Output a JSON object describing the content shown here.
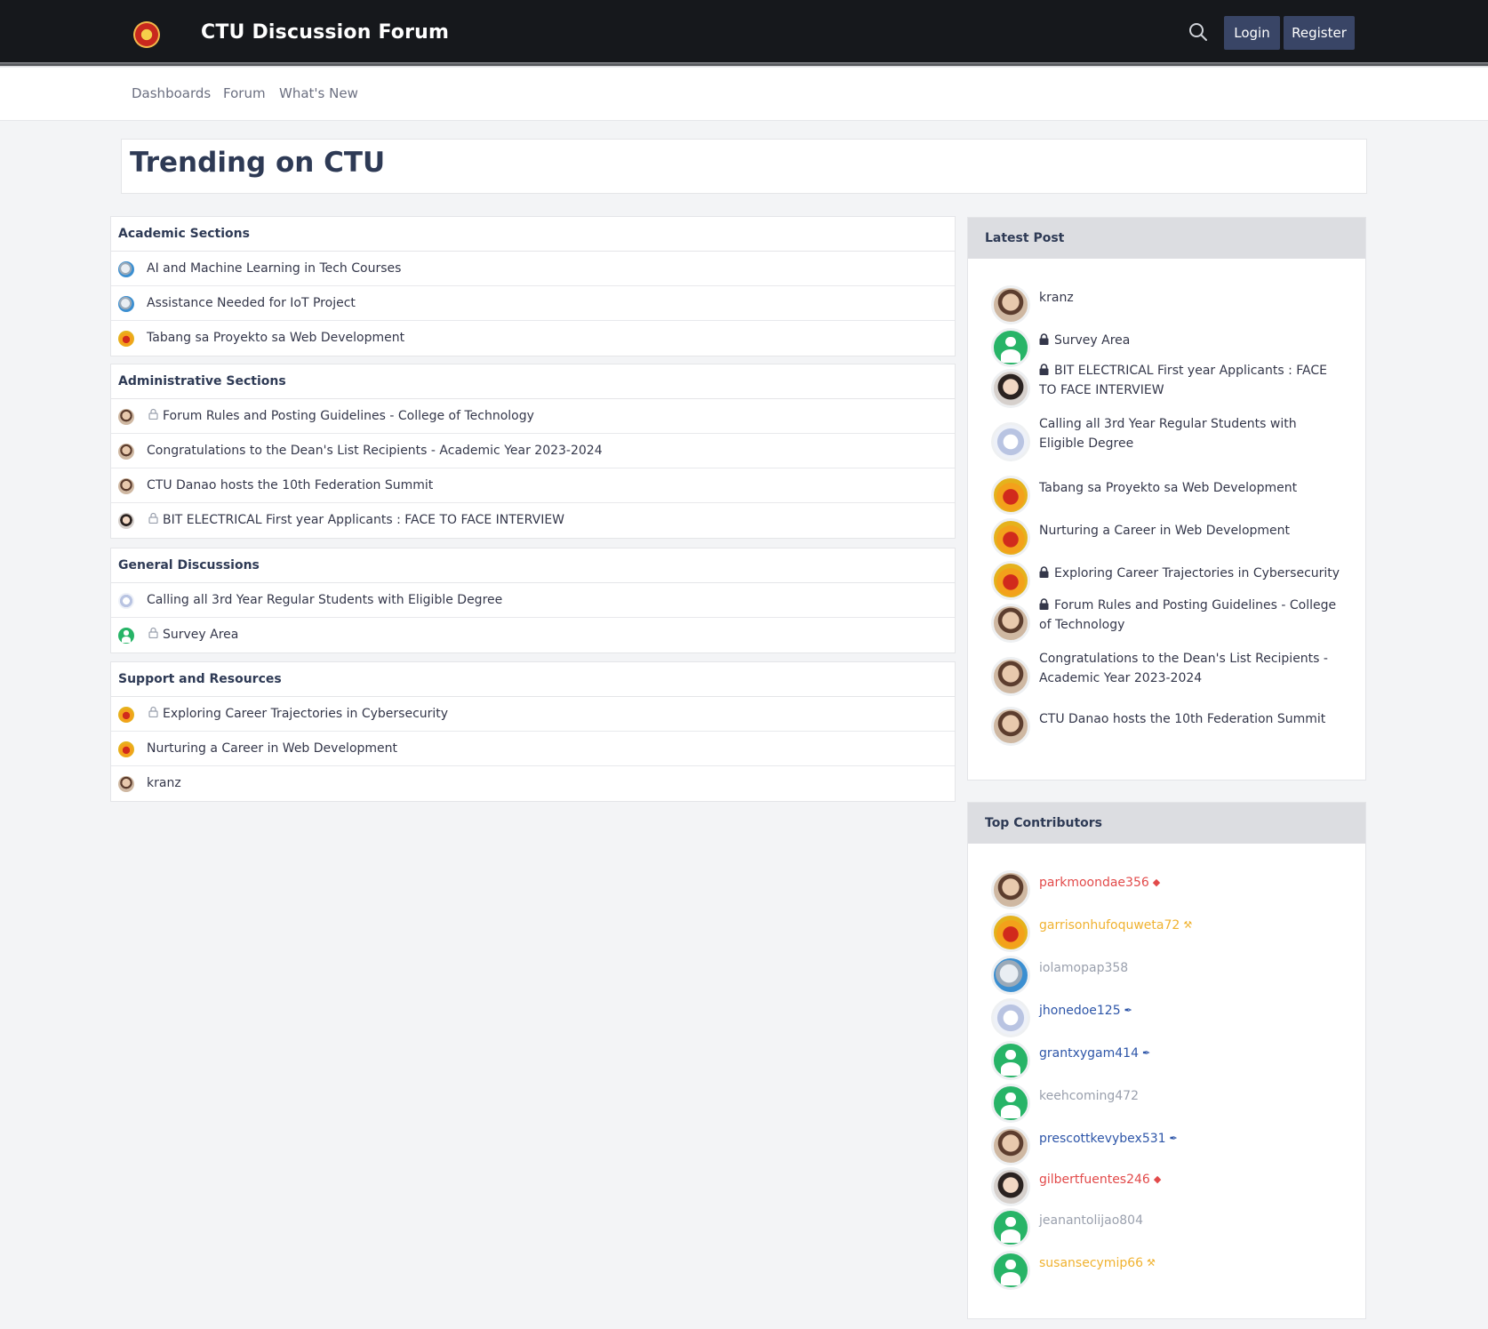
{
  "header": {
    "site_title": "CTU Discussion Forum",
    "login_label": "Login",
    "register_label": "Register"
  },
  "nav": {
    "items": [
      "Dashboards",
      "Forum",
      "What's New"
    ]
  },
  "page": {
    "title": "Trending on CTU"
  },
  "sections": [
    {
      "title": "Academic Sections",
      "rows": [
        {
          "label": "AI and Machine Learning in Tech Courses",
          "locked": false,
          "avatar": "blue"
        },
        {
          "label": "Assistance Needed for IoT Project",
          "locked": false,
          "avatar": "blue"
        },
        {
          "label": "Tabang sa Proyekto sa Web Development",
          "locked": false,
          "avatar": "orange"
        }
      ]
    },
    {
      "title": "Administrative Sections",
      "rows": [
        {
          "label": "Forum Rules and Posting Guidelines - College of Technology",
          "locked": true,
          "avatar": "face"
        },
        {
          "label": "Congratulations to the Dean's List Recipients - Academic Year 2023-2024",
          "locked": false,
          "avatar": "face"
        },
        {
          "label": "CTU Danao hosts the 10th Federation Summit",
          "locked": false,
          "avatar": "face"
        },
        {
          "label": "BIT ELECTRICAL First year Applicants : FACE TO FACE INTERVIEW",
          "locked": true,
          "avatar": "boy"
        }
      ]
    },
    {
      "title": "General Discussions",
      "rows": [
        {
          "label": "Calling all 3rd Year Regular Students with Eligible Degree",
          "locked": false,
          "avatar": "anime"
        },
        {
          "label": "Survey Area",
          "locked": true,
          "avatar": "green"
        }
      ]
    },
    {
      "title": "Support and Resources",
      "rows": [
        {
          "label": "Exploring Career Trajectories in Cybersecurity",
          "locked": true,
          "avatar": "orange"
        },
        {
          "label": "Nurturing a Career in Web Development",
          "locked": false,
          "avatar": "orange"
        },
        {
          "label": "kranz",
          "locked": false,
          "avatar": "face"
        }
      ]
    }
  ],
  "latest_post": {
    "title": "Latest Post",
    "items": [
      {
        "label": "kranz",
        "locked": false,
        "avatar": "face"
      },
      {
        "label": "Survey Area",
        "locked": true,
        "avatar": "green"
      },
      {
        "label": "BIT ELECTRICAL First year Applicants : FACE TO FACE INTERVIEW",
        "locked": true,
        "avatar": "boy"
      },
      {
        "label": "Calling all 3rd Year Regular Students with Eligible Degree",
        "locked": false,
        "avatar": "anime"
      },
      {
        "label": "Tabang sa Proyekto sa Web Development",
        "locked": false,
        "avatar": "orange"
      },
      {
        "label": "Nurturing a Career in Web Development",
        "locked": false,
        "avatar": "orange"
      },
      {
        "label": "Exploring Career Trajectories in Cybersecurity",
        "locked": true,
        "avatar": "orange"
      },
      {
        "label": "Forum Rules and Posting Guidelines - College of Technology",
        "locked": true,
        "avatar": "face"
      },
      {
        "label": "Congratulations to the Dean's List Recipients - Academic Year 2023-2024",
        "locked": false,
        "avatar": "face"
      },
      {
        "label": "CTU Danao hosts the 10th Federation Summit",
        "locked": false,
        "avatar": "face"
      }
    ]
  },
  "top_contributors": {
    "title": "Top Contributors",
    "items": [
      {
        "name": "parkmoondae356",
        "color": "#e24a4a",
        "badge": "shield-icon",
        "avatar": "face"
      },
      {
        "name": "garrisonhufoquweta72",
        "color": "#f0b230",
        "badge": "wrench-icon",
        "avatar": "orange"
      },
      {
        "name": "iolamopap358",
        "color": "#9aa0ad",
        "badge": "",
        "avatar": "blue"
      },
      {
        "name": "jhonedoe125",
        "color": "#2d55a8",
        "badge": "signature-icon",
        "avatar": "anime"
      },
      {
        "name": "grantxygam414",
        "color": "#2d55a8",
        "badge": "signature-icon",
        "avatar": "green"
      },
      {
        "name": "keehcoming472",
        "color": "#9aa0ad",
        "badge": "",
        "avatar": "green"
      },
      {
        "name": "prescottkevybex531",
        "color": "#2d55a8",
        "badge": "signature-icon",
        "avatar": "face"
      },
      {
        "name": "gilbertfuentes246",
        "color": "#e24a4a",
        "badge": "shield-icon",
        "avatar": "boy"
      },
      {
        "name": "jeanantolijao804",
        "color": "#9aa0ad",
        "badge": "",
        "avatar": "green"
      },
      {
        "name": "susansecymip66",
        "color": "#f0b230",
        "badge": "wrench-icon",
        "avatar": "green"
      }
    ]
  }
}
